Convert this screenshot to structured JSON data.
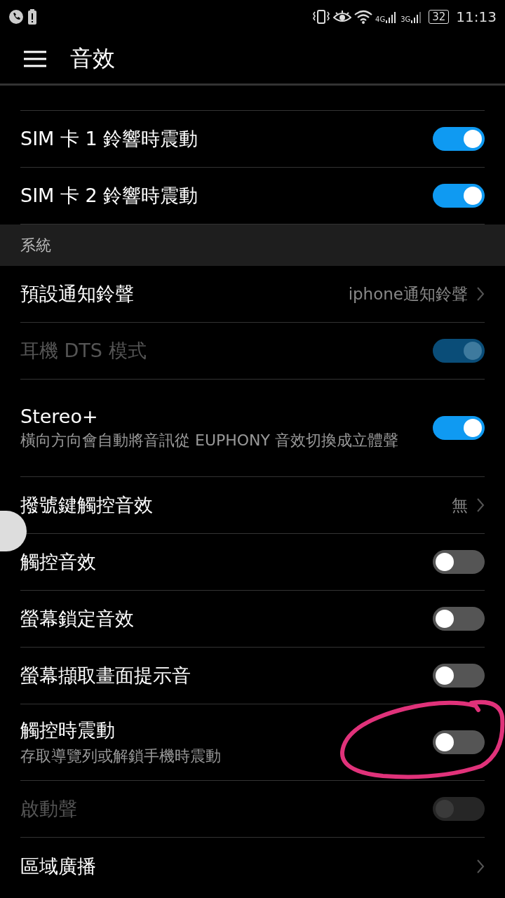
{
  "status_bar": {
    "network_1": "4G",
    "network_2": "3G",
    "battery": "32",
    "time": "11:13"
  },
  "app_bar": {
    "title": "音效"
  },
  "items": [
    {
      "kind": "toggle",
      "label": "SIM 卡 1 鈴響時震動",
      "on": true,
      "disabled": false
    },
    {
      "kind": "toggle",
      "label": "SIM 卡 2 鈴響時震動",
      "on": true,
      "disabled": false
    },
    {
      "kind": "header",
      "label": "系統"
    },
    {
      "kind": "link",
      "label": "預設通知鈴聲",
      "value": "iphone通知鈴聲",
      "disabled": false
    },
    {
      "kind": "toggle",
      "label": "耳機 DTS 模式",
      "on": true,
      "disabled": true
    },
    {
      "kind": "toggle",
      "label": "Stereo+",
      "summary": "橫向方向會自動將音訊從 EUPHONY 音效切換成立體聲",
      "on": true,
      "disabled": false
    },
    {
      "kind": "link",
      "label": "撥號鍵觸控音效",
      "value": "無",
      "disabled": false
    },
    {
      "kind": "toggle",
      "label": "觸控音效",
      "on": false,
      "disabled": false
    },
    {
      "kind": "toggle",
      "label": "螢幕鎖定音效",
      "on": false,
      "disabled": false
    },
    {
      "kind": "toggle",
      "label": "螢幕擷取畫面提示音",
      "on": false,
      "disabled": false
    },
    {
      "kind": "toggle",
      "label": "觸控時震動",
      "summary": "存取導覽列或解鎖手機時震動",
      "on": false,
      "disabled": false
    },
    {
      "kind": "toggle",
      "label": "啟動聲",
      "on": false,
      "disabled": true
    },
    {
      "kind": "link",
      "label": "區域廣播",
      "disabled": false
    }
  ]
}
